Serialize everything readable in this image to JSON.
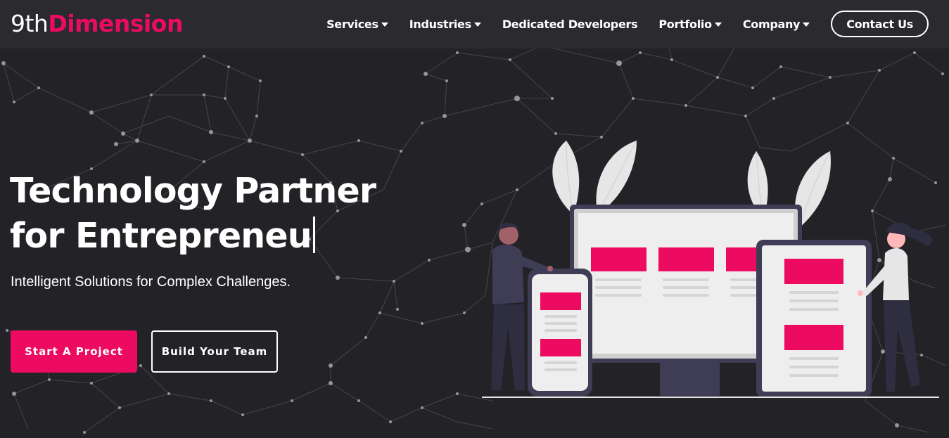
{
  "header": {
    "logo_prefix": "9th",
    "logo_brand": "Dimension",
    "nav": [
      {
        "label": "Services",
        "has_dropdown": true
      },
      {
        "label": "Industries",
        "has_dropdown": true
      },
      {
        "label": "Dedicated Developers",
        "has_dropdown": false
      },
      {
        "label": "Portfolio",
        "has_dropdown": true
      },
      {
        "label": "Company",
        "has_dropdown": true
      }
    ],
    "contact_label": "Contact Us"
  },
  "hero": {
    "title_line1": "Technology Partner",
    "title_line2": "for  Entrepreneu",
    "subtitle": "Intelligent Solutions for Complex Challenges.",
    "primary_cta": "Start A Project",
    "secondary_cta": "Build Your Team"
  },
  "icons": {
    "nav_dropdown": "caret-down-icon"
  },
  "colors": {
    "background": "#232226",
    "header": "#2b2a2e",
    "accent": "#ec0b61",
    "text": "#ffffff"
  }
}
